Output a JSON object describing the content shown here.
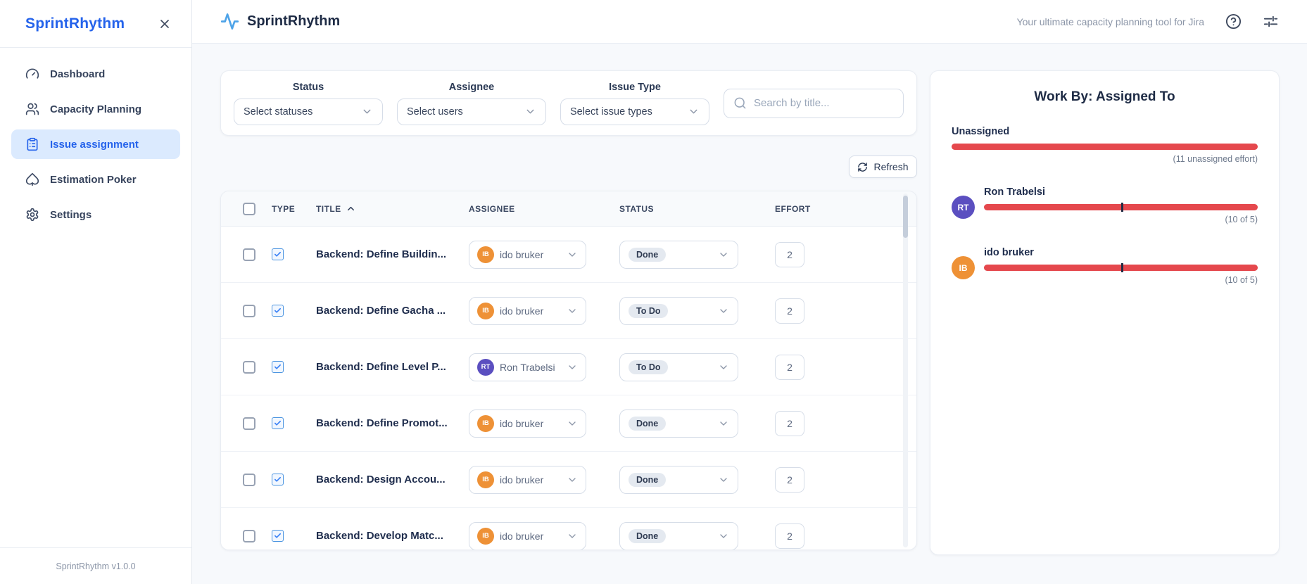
{
  "app": {
    "title": "SprintRhythm",
    "tagline": "Your ultimate capacity planning tool for Jira",
    "version_label": "SprintRhythm v1.0.0"
  },
  "sidebar": {
    "title": "SprintRhythm",
    "items": [
      {
        "label": "Dashboard",
        "icon": "gauge",
        "active": false
      },
      {
        "label": "Capacity Planning",
        "icon": "users",
        "active": false
      },
      {
        "label": "Issue assignment",
        "icon": "clipboard-list",
        "active": true
      },
      {
        "label": "Estimation Poker",
        "icon": "spade",
        "active": false
      },
      {
        "label": "Settings",
        "icon": "gear",
        "active": false
      }
    ]
  },
  "filters": {
    "status": {
      "label": "Status",
      "value": "Select statuses"
    },
    "assignee": {
      "label": "Assignee",
      "value": "Select users"
    },
    "issue_type": {
      "label": "Issue Type",
      "value": "Select issue types"
    },
    "search": {
      "placeholder": "Search by title..."
    }
  },
  "toolbar": {
    "refresh_label": "Refresh"
  },
  "table": {
    "headers": {
      "type": "TYPE",
      "title": "TITLE",
      "assignee": "ASSIGNEE",
      "status": "STATUS",
      "effort": "EFFORT"
    },
    "sort_column": "TITLE",
    "sort_direction": "ascending",
    "rows": [
      {
        "type": "task",
        "title": "Backend: Define Buildin...",
        "assignee": "ido bruker",
        "initials": "IB",
        "avatar_color": "#ee9136",
        "status": "Done",
        "effort": "2",
        "selected": false
      },
      {
        "type": "task",
        "title": "Backend: Define Gacha ...",
        "assignee": "ido bruker",
        "initials": "IB",
        "avatar_color": "#ee9136",
        "status": "To Do",
        "effort": "2",
        "selected": false
      },
      {
        "type": "task",
        "title": "Backend: Define Level P...",
        "assignee": "Ron Trabelsi",
        "initials": "RT",
        "avatar_color": "#5b4fc0",
        "status": "To Do",
        "effort": "2",
        "selected": false
      },
      {
        "type": "task",
        "title": "Backend: Define Promot...",
        "assignee": "ido bruker",
        "initials": "IB",
        "avatar_color": "#ee9136",
        "status": "Done",
        "effort": "2",
        "selected": false
      },
      {
        "type": "task",
        "title": "Backend: Design Accou...",
        "assignee": "ido bruker",
        "initials": "IB",
        "avatar_color": "#ee9136",
        "status": "Done",
        "effort": "2",
        "selected": false
      },
      {
        "type": "task",
        "title": "Backend: Develop Matc...",
        "assignee": "ido bruker",
        "initials": "IB",
        "avatar_color": "#ee9136",
        "status": "Done",
        "effort": "2",
        "selected": false
      }
    ]
  },
  "work_by": {
    "title": "Work By: Assigned To",
    "unassigned": {
      "label": "Unassigned",
      "caption": "(11 unassigned effort)",
      "fill_percent": 100
    },
    "people": [
      {
        "name": "Ron Trabelsi",
        "initials": "RT",
        "avatar_color": "#5b4fc0",
        "caption": "(10 of 5)",
        "effort": 10,
        "capacity": 5,
        "fill_percent": 100,
        "capacity_marker_percent": 50
      },
      {
        "name": "ido bruker",
        "initials": "IB",
        "avatar_color": "#ee9136",
        "caption": "(10 of 5)",
        "effort": 10,
        "capacity": 5,
        "fill_percent": 100,
        "capacity_marker_percent": 50
      }
    ]
  },
  "colors": {
    "accent_blue": "#2563eb",
    "active_nav_bg": "#dbeafe",
    "logo_blue": "#4da3e8",
    "overload_red": "#e5484d",
    "capacity_marker": "#232c44",
    "avatar_orange": "#ee9136",
    "avatar_purple": "#5b4fc0"
  }
}
